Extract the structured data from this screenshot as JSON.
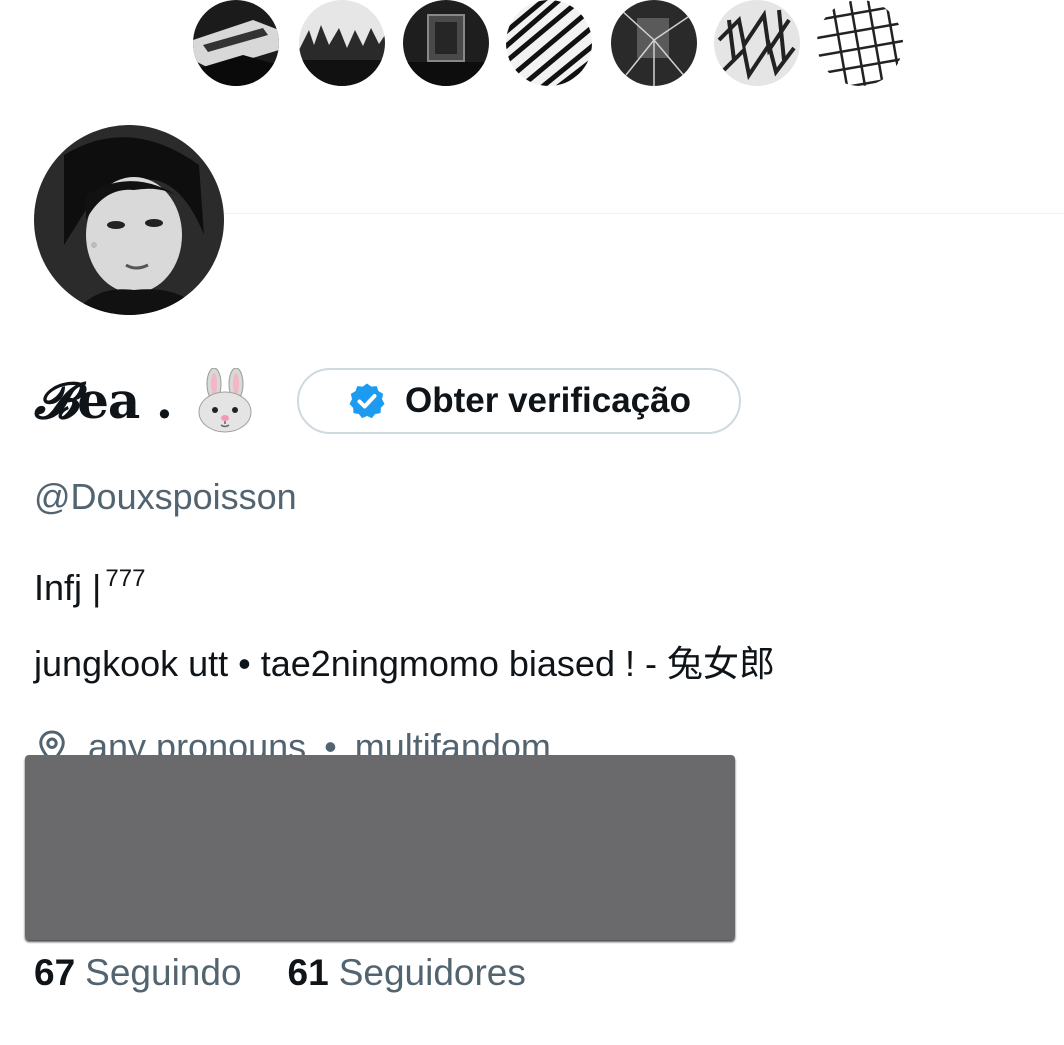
{
  "banner": {
    "images": [
      {
        "name": "header-image-1",
        "kind": "dark-abstract"
      },
      {
        "name": "header-image-2",
        "kind": "forest"
      },
      {
        "name": "header-image-3",
        "kind": "dark-room"
      },
      {
        "name": "header-image-4",
        "kind": "diagonal-stripes"
      },
      {
        "name": "header-image-5",
        "kind": "cracked-glass"
      },
      {
        "name": "header-image-6",
        "kind": "scribbles"
      },
      {
        "name": "header-image-7",
        "kind": "crosshatch"
      }
    ]
  },
  "profile": {
    "display_name_script": "𝓑",
    "display_name_rest": "ea .",
    "name_emoji": "rabbit-face-icon",
    "verify_button_label": "Obter verificação",
    "handle": "@Douxspoisson",
    "bio_line1": "Infj |",
    "bio_line1_sup": "777",
    "bio_line2": "jungkook utt • tae2ningmomo biased !  - 兔女郎",
    "location": "any pronouns",
    "location_separator": "•",
    "location_extra": "multifandom",
    "following_count": "67",
    "following_label": "Seguindo",
    "followers_count": "61",
    "followers_label": "Seguidores"
  },
  "colors": {
    "text_primary": "#0f1419",
    "text_secondary": "#536471",
    "verified_blue": "#1d9bf0",
    "button_border": "#cfd9de",
    "redaction": "#6a6a6c"
  }
}
